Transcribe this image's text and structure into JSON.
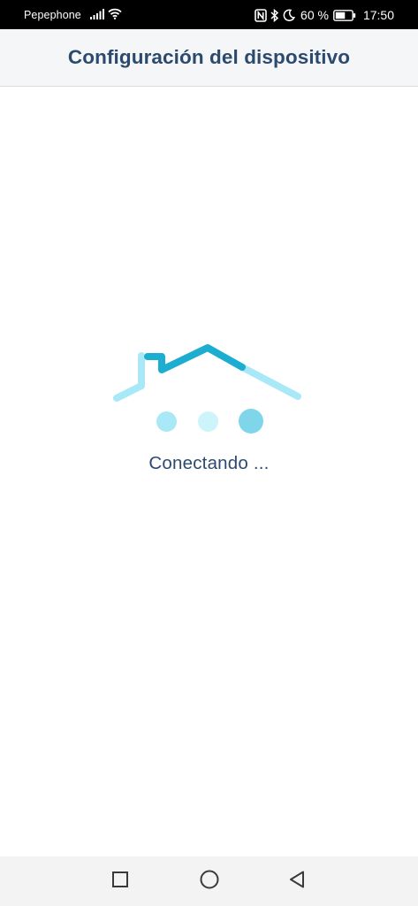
{
  "status_bar": {
    "carrier": "Pepephone",
    "battery_percent": "60 %",
    "time": "17:50",
    "icons": [
      "signal-icon",
      "wifi-icon",
      "nfc-icon",
      "bluetooth-icon",
      "moon-icon",
      "battery-icon"
    ]
  },
  "header": {
    "title": "Configuración del dispositivo",
    "background": "#f5f6f8",
    "title_color": "#2c4a6e"
  },
  "loader": {
    "icon": "house-loader-icon",
    "status_text": "Conectando ...",
    "colors": {
      "roof_active": "#1cadd0",
      "roof_inactive": "#a9e9f7",
      "dot_1": "#a9e9f7",
      "dot_2": "#cdf3fb",
      "dot_3": "#7fd6ea"
    }
  },
  "navigation": {
    "icons": [
      "square-recents-icon",
      "circle-home-icon",
      "triangle-back-icon"
    ]
  }
}
